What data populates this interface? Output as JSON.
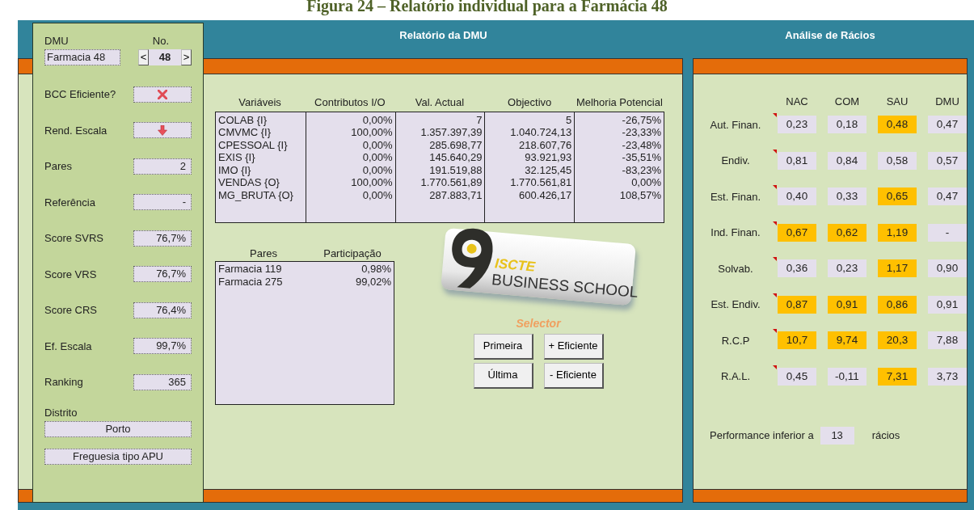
{
  "caption": "Figura 24 – Relatório individual para a Farmácia 48",
  "dmu": {
    "label": "DMU",
    "value": "Farmacia 48"
  },
  "number": {
    "label": "No.",
    "value": "48",
    "prev": "<",
    "next": ">"
  },
  "indicators": [
    {
      "label": "BCC Eficiente?",
      "kind": "cross"
    },
    {
      "label": "Rend. Escala",
      "kind": "down-arrow"
    },
    {
      "label": "Pares",
      "kind": "text",
      "value": "2"
    },
    {
      "label": "Referência",
      "kind": "text",
      "value": "-"
    },
    {
      "label": "Score SVRS",
      "kind": "text",
      "value": "76,7%"
    },
    {
      "label": "Score VRS",
      "kind": "text",
      "value": "76,7%"
    },
    {
      "label": "Score CRS",
      "kind": "text",
      "value": "76,4%"
    },
    {
      "label": "Ef. Escala",
      "kind": "text",
      "value": "99,7%"
    },
    {
      "label": "Ranking",
      "kind": "text",
      "value": "365"
    }
  ],
  "district": {
    "label": "Distrito",
    "value": "Porto"
  },
  "parish_type": "Freguesia tipo APU",
  "report": {
    "title": "Relatório da DMU",
    "columns": [
      "Variáveis",
      "Contributos I/O",
      "Val. Actual",
      "Objectivo",
      "Melhoria Potencial"
    ],
    "rows": [
      [
        "COLAB {I}",
        "0,00%",
        "7",
        "5",
        "-26,75%"
      ],
      [
        "CMVMC {I}",
        "100,00%",
        "1.357.397,39",
        "1.040.724,13",
        "-23,33%"
      ],
      [
        "CPESSOAL {I}",
        "0,00%",
        "285.698,77",
        "218.607,76",
        "-23,48%"
      ],
      [
        "EXIS {I}",
        "0,00%",
        "145.640,29",
        "93.921,93",
        "-35,51%"
      ],
      [
        "IMO {I}",
        "0,00%",
        "191.519,88",
        "32.125,45",
        "-83,23%"
      ],
      [
        "VENDAS {O}",
        "100,00%",
        "1.770.561,89",
        "1.770.561,81",
        "0,00%"
      ],
      [
        "MG_BRUTA {O}",
        "0,00%",
        "287.883,71",
        "600.426,17",
        "108,57%"
      ]
    ]
  },
  "peers": {
    "columns": [
      "Pares",
      "Participação"
    ],
    "rows": [
      [
        "Farmacia 119",
        "0,98%"
      ],
      [
        "Farmacia 275",
        "99,02%"
      ]
    ]
  },
  "logo": {
    "top": "ISCTE",
    "bottom": "BUSINESS SCHOOL"
  },
  "selector": {
    "label": "Selector",
    "buttons": [
      "Primeira",
      "+ Eficiente",
      "Última",
      "- Eficiente"
    ]
  },
  "ratios": {
    "title": "Análise de Rácios",
    "columns": [
      "NAC",
      "COM",
      "SAU",
      "DMU"
    ],
    "rows": [
      {
        "label": "Aut. Finan.",
        "cells": [
          {
            "value": "0,23",
            "highlight": false
          },
          {
            "value": "0,18",
            "highlight": false
          },
          {
            "value": "0,48",
            "highlight": true
          },
          {
            "value": "0,47",
            "highlight": false
          }
        ]
      },
      {
        "label": "Endiv.",
        "cells": [
          {
            "value": "0,81",
            "highlight": false
          },
          {
            "value": "0,84",
            "highlight": false
          },
          {
            "value": "0,58",
            "highlight": false
          },
          {
            "value": "0,57",
            "highlight": false
          }
        ]
      },
      {
        "label": "Est. Finan.",
        "cells": [
          {
            "value": "0,40",
            "highlight": false
          },
          {
            "value": "0,33",
            "highlight": false
          },
          {
            "value": "0,65",
            "highlight": true
          },
          {
            "value": "0,47",
            "highlight": false
          }
        ]
      },
      {
        "label": "Ind. Finan.",
        "cells": [
          {
            "value": "0,67",
            "highlight": true
          },
          {
            "value": "0,62",
            "highlight": true
          },
          {
            "value": "1,19",
            "highlight": true
          },
          {
            "value": "-",
            "highlight": false
          }
        ]
      },
      {
        "label": "Solvab.",
        "cells": [
          {
            "value": "0,36",
            "highlight": false
          },
          {
            "value": "0,23",
            "highlight": false
          },
          {
            "value": "1,17",
            "highlight": true
          },
          {
            "value": "0,90",
            "highlight": false
          }
        ]
      },
      {
        "label": "Est. Endiv.",
        "cells": [
          {
            "value": "0,87",
            "highlight": true
          },
          {
            "value": "0,91",
            "highlight": true
          },
          {
            "value": "0,86",
            "highlight": true
          },
          {
            "value": "0,91",
            "highlight": false
          }
        ]
      },
      {
        "label": "R.C.P",
        "cells": [
          {
            "value": "10,7",
            "highlight": true
          },
          {
            "value": "9,74",
            "highlight": true
          },
          {
            "value": "20,3",
            "highlight": true
          },
          {
            "value": "7,88",
            "highlight": false
          }
        ]
      },
      {
        "label": "R.A.L.",
        "cells": [
          {
            "value": "0,45",
            "highlight": false
          },
          {
            "value": "-0,11",
            "highlight": false
          },
          {
            "value": "7,31",
            "highlight": true
          },
          {
            "value": "3,73",
            "highlight": false
          }
        ]
      }
    ]
  },
  "performance": {
    "prefix": "Performance inferior a",
    "value": "13",
    "suffix": "rácios"
  }
}
